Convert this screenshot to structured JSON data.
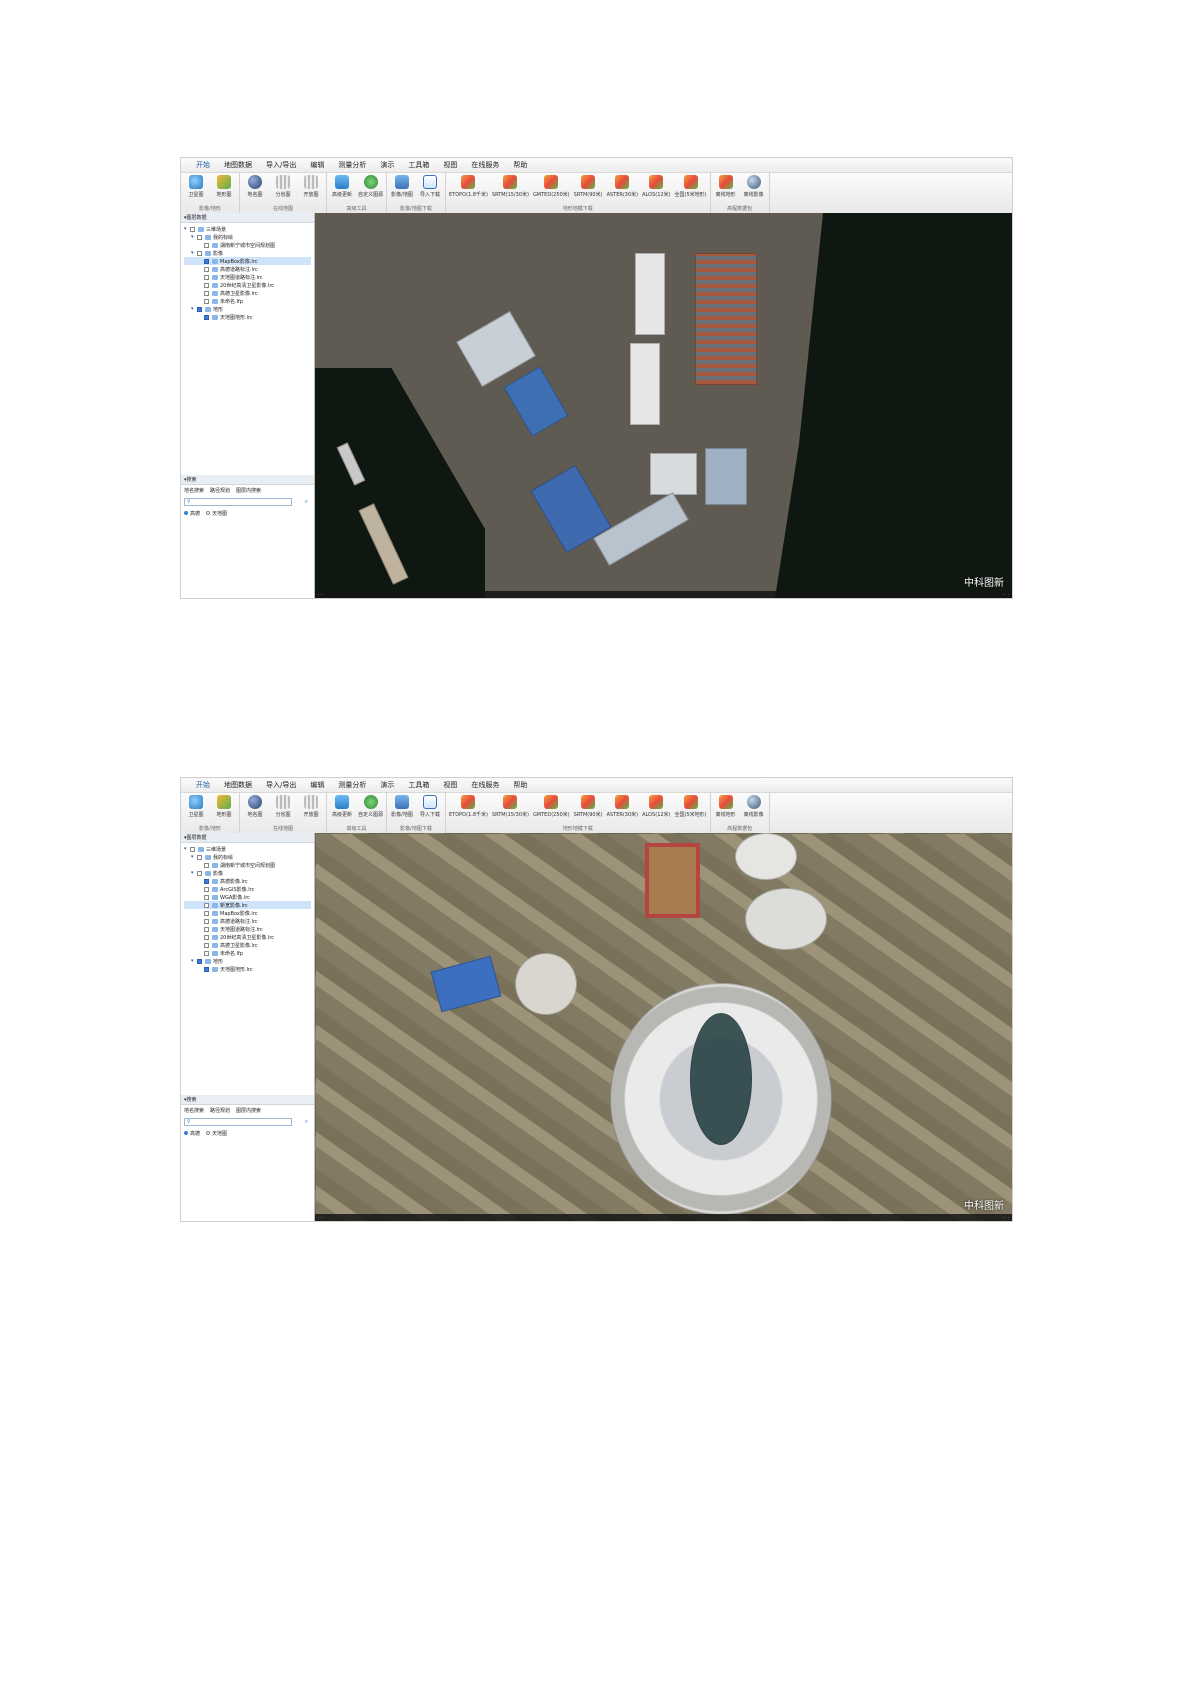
{
  "menu": [
    "开始",
    "地图数据",
    "导入/导出",
    "编辑",
    "测量分析",
    "演示",
    "工具箱",
    "视图",
    "在线服务",
    "帮助"
  ],
  "ribbon": {
    "groups": [
      {
        "label": "影像/地形",
        "buttons": [
          {
            "label": "卫星图",
            "icon": "satellite-icon"
          },
          {
            "label": "地形图",
            "icon": "terrain-icon"
          }
        ]
      },
      {
        "label": "在线地图",
        "buttons": [
          {
            "label": "地名图",
            "icon": "globe-icon"
          },
          {
            "label": "分省图",
            "icon": "province-icon"
          },
          {
            "label": "开放图",
            "icon": "open-map-icon"
          }
        ]
      },
      {
        "label": "高级工具",
        "buttons": [
          {
            "label": "高级更新",
            "icon": "update-icon"
          },
          {
            "label": "自定义图源",
            "icon": "custom-source-icon"
          }
        ]
      },
      {
        "label": "影像/地图下载",
        "buttons": [
          {
            "label": "影像/地图",
            "icon": "image-map-icon"
          },
          {
            "label": "导入下载",
            "icon": "import-download-icon"
          }
        ]
      },
      {
        "label": "地形地模下载",
        "buttons": [
          {
            "label": "ETOPO(1.8千米)",
            "icon": "dem-icon"
          },
          {
            "label": "SRTM(15/30米)",
            "icon": "dem-icon"
          },
          {
            "label": "GMTED(250米)",
            "icon": "dem-icon"
          },
          {
            "label": "SRTM(90米)",
            "icon": "dem-icon"
          },
          {
            "label": "ASTER(30米)",
            "icon": "dem-icon"
          },
          {
            "label": "ALOS(12米)",
            "icon": "dem-icon"
          },
          {
            "label": "全国(5米地形)",
            "icon": "dem-icon"
          }
        ]
      },
      {
        "label": "高程数据包",
        "buttons": [
          {
            "label": "离线地形",
            "icon": "offline-terrain-icon"
          },
          {
            "label": "离线影像",
            "icon": "offline-image-icon"
          }
        ]
      }
    ]
  },
  "panels": {
    "layers_title": "图层数据",
    "search_title": "搜索"
  },
  "search": {
    "tabs": [
      "地名搜索",
      "路径规划",
      "图层内搜索"
    ],
    "placeholder": "",
    "options": [
      {
        "label": "高德",
        "on": true
      },
      {
        "label": "天地图",
        "on": false
      }
    ]
  },
  "screens": [
    {
      "tree": [
        {
          "level": 0,
          "label": "三维场景",
          "checked": false,
          "expanded": true
        },
        {
          "level": 1,
          "label": "我的标绘",
          "checked": false,
          "expanded": true
        },
        {
          "level": 2,
          "label": "湖南新宁城市空间规划图",
          "checked": false
        },
        {
          "level": 1,
          "label": "影像",
          "checked": false,
          "expanded": true
        },
        {
          "level": 2,
          "label": "MapBox影像.lrc",
          "checked": true,
          "selected": true
        },
        {
          "level": 2,
          "label": "高德道路标注.lrc",
          "checked": false
        },
        {
          "level": 2,
          "label": "天地图道路标注.lrc",
          "checked": false
        },
        {
          "level": 2,
          "label": "20世纪高清卫星影像.lrc",
          "checked": false
        },
        {
          "level": 2,
          "label": "高德卫星影像.lrc",
          "checked": false
        },
        {
          "level": 2,
          "label": "未命名.lfp",
          "checked": false
        },
        {
          "level": 1,
          "label": "地形",
          "checked": true,
          "expanded": true
        },
        {
          "level": 2,
          "label": "天地图地形.lrc",
          "checked": true
        }
      ],
      "watermark": "中科图新"
    },
    {
      "tree": [
        {
          "level": 0,
          "label": "三维场景",
          "checked": false,
          "expanded": true
        },
        {
          "level": 1,
          "label": "我的标绘",
          "checked": false,
          "expanded": true
        },
        {
          "level": 2,
          "label": "湖南新宁城市空间规划图",
          "checked": false
        },
        {
          "level": 1,
          "label": "影像",
          "checked": false,
          "expanded": true
        },
        {
          "level": 2,
          "label": "高德影像.lrc",
          "checked": true
        },
        {
          "level": 2,
          "label": "ArcGIS影像.lrc",
          "checked": false
        },
        {
          "level": 2,
          "label": "WGA影像.lrc",
          "checked": false
        },
        {
          "level": 2,
          "label": "新宽影像.lrc",
          "checked": false,
          "selected": true
        },
        {
          "level": 2,
          "label": "MapBox影像.lrc",
          "checked": false
        },
        {
          "level": 2,
          "label": "高德道路标注.lrc",
          "checked": false
        },
        {
          "level": 2,
          "label": "天地图道路标注.lrc",
          "checked": false
        },
        {
          "level": 2,
          "label": "20世纪高清卫星影像.lrc",
          "checked": false
        },
        {
          "level": 2,
          "label": "高德卫星影像.lrc",
          "checked": false
        },
        {
          "level": 2,
          "label": "未命名.lfp",
          "checked": false
        },
        {
          "level": 1,
          "label": "地形",
          "checked": true,
          "expanded": true
        },
        {
          "level": 2,
          "label": "天地图地形.lrc",
          "checked": true
        }
      ],
      "watermark": "中科图新"
    }
  ]
}
